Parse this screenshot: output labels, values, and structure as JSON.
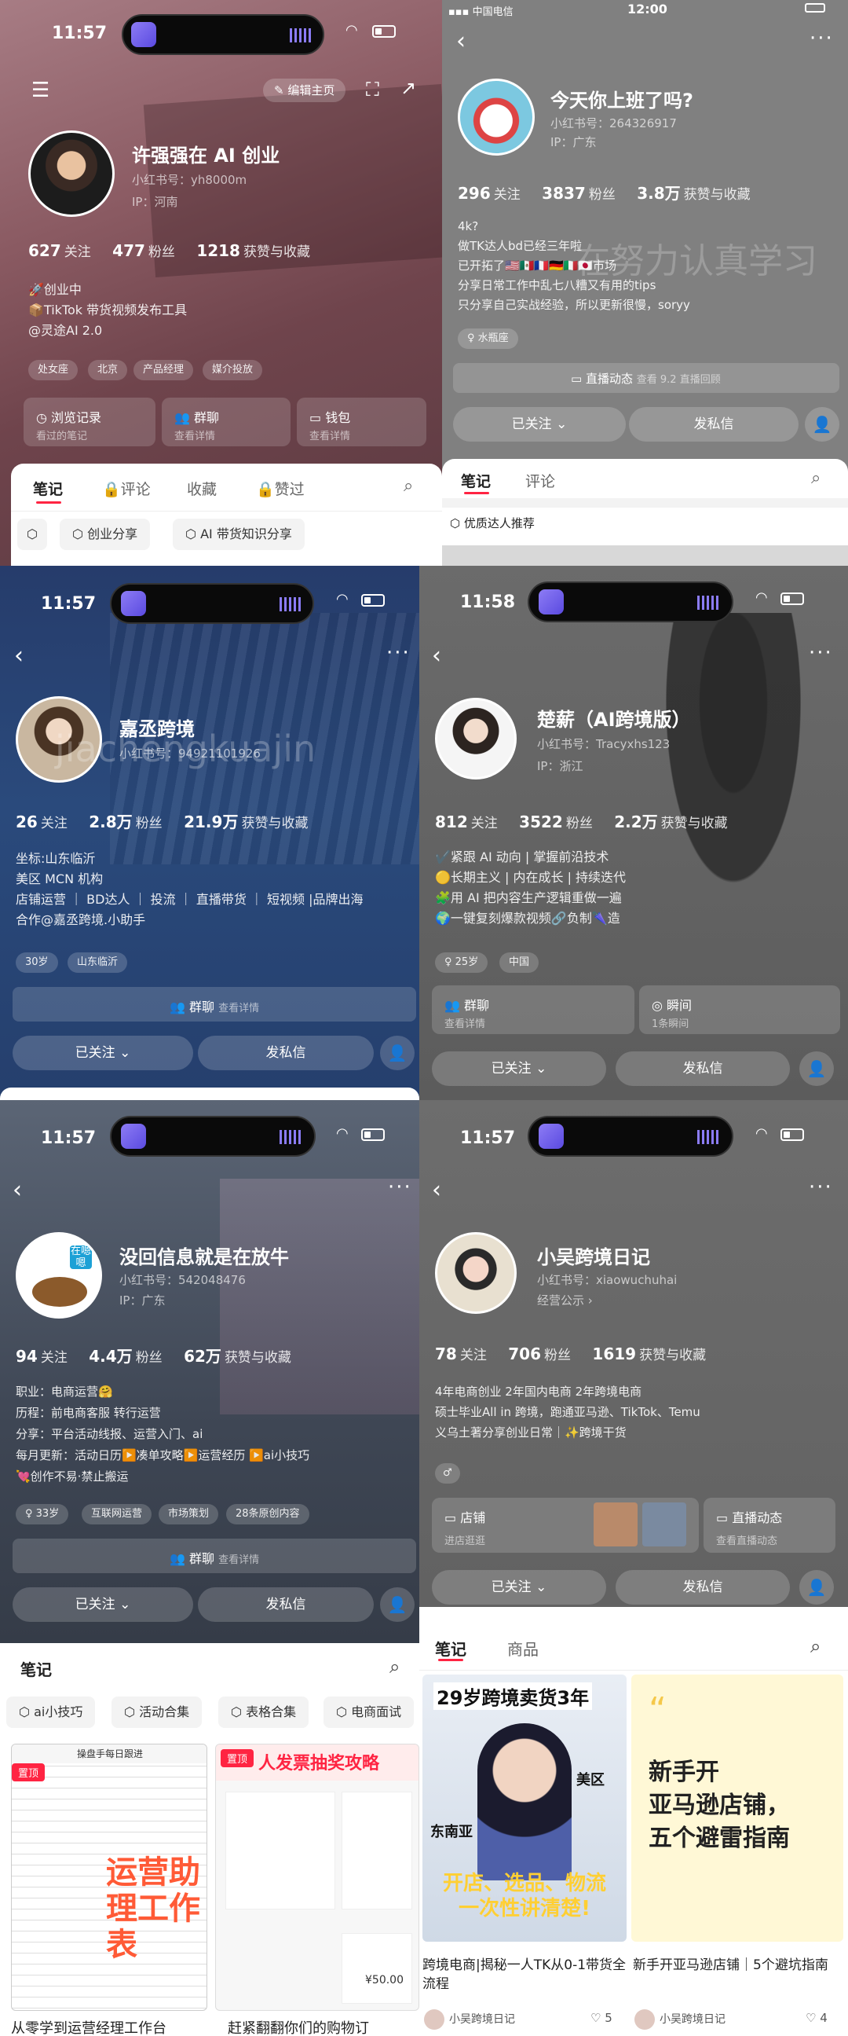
{
  "panel1": {
    "time": "11:57",
    "edit_label": "编辑主页",
    "name": "许强强在 AI 创业",
    "id": "小红书号：yh8000m",
    "ip": "IP：河南",
    "stats": {
      "follow_num": "627",
      "follow_label": "关注",
      "fans_num": "477",
      "fans_label": "粉丝",
      "likes_num": "1218",
      "likes_label": "获赞与收藏"
    },
    "bio": "🚀创业中\n📦TikTok 带货视频发布工具\n@灵途AI 2.0",
    "tags": [
      "处女座",
      "北京",
      "产品经理",
      "媒介投放"
    ],
    "cards": [
      {
        "title": "浏览记录",
        "sub": "看过的笔记"
      },
      {
        "title": "群聊",
        "sub": "查看详情"
      },
      {
        "title": "钱包",
        "sub": "查看详情"
      }
    ],
    "tabs": [
      "笔记",
      "评论",
      "收藏",
      "赞过"
    ],
    "chips": [
      "创业分享",
      "AI 带货知识分享"
    ]
  },
  "panel2": {
    "carrier": "中国电信",
    "time": "12:00",
    "name": "今天你上班了吗?",
    "id": "小红书号：264326917",
    "ip": "IP：广东",
    "stats": {
      "follow_num": "296",
      "follow_label": "关注",
      "fans_num": "3837",
      "fans_label": "粉丝",
      "likes_num": "3.8万",
      "likes_label": "获赞与收藏"
    },
    "bio": "4k?\n做TK达人bd已经三年啦\n已开拓了🇺🇸🇲🇽🇫🇷🇩🇪🇮🇹🇯🇵市场\n分享日常工作中乱七八糟又有用的tips\n只分享自己实战经验，所以更新很慢，soryy",
    "watermark": "在努力认真学习",
    "tags": [
      "水瓶座"
    ],
    "live_label": "直播动态",
    "live_sub": "查看 9.2 直播回顾",
    "follow_btn": "已关注",
    "message_btn": "发私信",
    "tabs": [
      "笔记",
      "评论"
    ],
    "chip": "优质达人推荐"
  },
  "panel3": {
    "time": "11:57",
    "name": "嘉丞跨境",
    "id": "小红书号：94921101926",
    "watermark": "jiachengkuajin",
    "stats": {
      "follow_num": "26",
      "follow_label": "关注",
      "fans_num": "2.8万",
      "fans_label": "粉丝",
      "likes_num": "21.9万",
      "likes_label": "获赞与收藏"
    },
    "bio": "坐标:山东临沂\n美区 MCN 机构\n店铺运营 ｜ BD达人 ｜ 投流 ｜ 直播带货 ｜ 短视频 |品牌出海\n合作@嘉丞跨境.小助手",
    "tags": [
      "30岁",
      "山东临沂"
    ],
    "group_label": "群聊",
    "group_sub": "查看详情",
    "follow_btn": "已关注",
    "message_btn": "发私信"
  },
  "panel4": {
    "time": "11:58",
    "name": "楚薪（AI跨境版）",
    "id": "小红书号：Tracyxhs123",
    "ip": "IP：浙江",
    "stats": {
      "follow_num": "812",
      "follow_label": "关注",
      "fans_num": "3522",
      "fans_label": "粉丝",
      "likes_num": "2.2万",
      "likes_label": "获赞与收藏"
    },
    "bio": "✔️紧跟 AI 动向 | 掌握前沿技术\n🟡长期主义 | 内在成长 | 持续迭代\n🧩用 AI 把内容生产逻辑重做一遍\n🌍一键复刻爆款视频🔗负制🌂造",
    "tags": [
      "25岁",
      "中国"
    ],
    "cards": [
      {
        "title": "群聊",
        "sub": "查看详情"
      },
      {
        "title": "瞬间",
        "sub": "1条瞬间"
      }
    ],
    "follow_btn": "已关注",
    "message_btn": "发私信"
  },
  "panel5": {
    "time": "11:57",
    "name": "没回信息就是在放牛",
    "id": "小红书号：542048476",
    "ip": "IP：广东",
    "avatar_text": "在嗯嗯",
    "stats": {
      "follow_num": "94",
      "follow_label": "关注",
      "fans_num": "4.4万",
      "fans_label": "粉丝",
      "likes_num": "62万",
      "likes_label": "获赞与收藏"
    },
    "bio": "职业：电商运营🤗\n历程：前电商客服 转行运营\n分享：平台活动线报、运营入门、ai\n每月更新：活动日历▶️凑单攻略▶️运营经历 ▶️ai小技巧\n💘创作不易·禁止搬运",
    "tags": [
      "33岁",
      "互联网运营",
      "市场策划",
      "28条原创内容"
    ],
    "group_label": "群聊",
    "group_sub": "查看详情",
    "follow_btn": "已关注",
    "message_btn": "发私信"
  },
  "panel6": {
    "time": "11:57",
    "name": "小吴跨境日记",
    "id": "小红书号：xiaowuchuhai",
    "extra": "经营公示",
    "stats": {
      "follow_num": "78",
      "follow_label": "关注",
      "fans_num": "706",
      "fans_label": "粉丝",
      "likes_num": "1619",
      "likes_label": "获赞与收藏"
    },
    "bio": "4年电商创业  2年国内电商 2年跨境电商\n硕士毕业All in 跨境，跑通亚马逊、TikTok、Temu\n义乌土著分享创业日常｜✨跨境干货",
    "shop_label": "店铺",
    "shop_sub": "进店逛逛",
    "live_label": "直播动态",
    "live_sub": "查看直播动态",
    "follow_btn": "已关注",
    "message_btn": "发私信"
  },
  "panel7": {
    "tab": "笔记",
    "chips": [
      "ai小技巧",
      "活动合集",
      "表格合集",
      "电商面试"
    ],
    "note1_badge": "置顶",
    "note1_title": "运营助理工作表",
    "note1_head": "操盘手每日跟进",
    "note2_badge": "置顶",
    "note2_title": "人发票抽奖攻略",
    "note2_price": "¥50.00",
    "caption_left": "从零学到运营经理工作台",
    "caption_right": "赶紧翻翻你们的购物订"
  },
  "panel8": {
    "tabs": [
      "笔记",
      "商品"
    ],
    "notes": [
      {
        "headline": "29岁跨境卖货3年",
        "label1": "美区",
        "label2": "东南亚",
        "subline": "开店、选品、物流\n一次性讲清楚!",
        "title": "跨境电商|揭秘一人TK从0-1带货全流程",
        "author": "小吴跨境日记",
        "likes": "5"
      },
      {
        "headline": "新手开\n亚马逊店铺，\n五个避雷指南",
        "title": "新手开亚马逊店铺｜5个避坑指南",
        "author": "小吴跨境日记",
        "likes": "4"
      }
    ]
  }
}
